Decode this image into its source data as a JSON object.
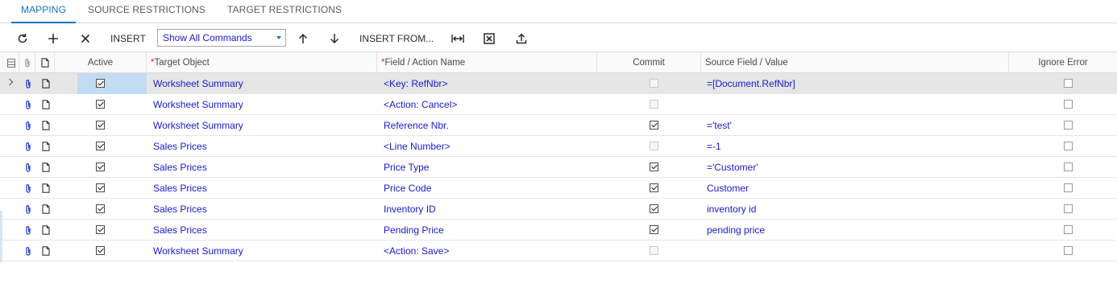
{
  "tabs": [
    {
      "label": "MAPPING"
    },
    {
      "label": "SOURCE RESTRICTIONS"
    },
    {
      "label": "TARGET RESTRICTIONS"
    }
  ],
  "toolbar": {
    "refresh_icon": "refresh-icon",
    "add_icon": "plus-icon",
    "delete_icon": "close-icon",
    "insert_label": "INSERT",
    "commands_select": "Show All Commands",
    "up_icon": "arrow-up-icon",
    "down_icon": "arrow-down-icon",
    "insert_from_label": "INSERT FROM...",
    "fit_icon": "fit-columns-icon",
    "excel_icon": "export-excel-icon",
    "upload_icon": "upload-icon"
  },
  "columns": {
    "active": "Active",
    "target_object": "Target Object",
    "field_action": "Field / Action Name",
    "commit": "Commit",
    "source_value": "Source Field / Value",
    "ignore_error": "Ignore Error",
    "required_mark": "*"
  },
  "rows": [
    {
      "active": true,
      "target": "Worksheet Summary",
      "field": "<Key: RefNbr>",
      "commit": false,
      "commit_enabled": false,
      "source": "=[Document.RefNbr]",
      "ignore": false,
      "selected": true
    },
    {
      "active": true,
      "target": "Worksheet Summary",
      "field": "<Action: Cancel>",
      "commit": false,
      "commit_enabled": false,
      "source": "",
      "ignore": false,
      "selected": false
    },
    {
      "active": true,
      "target": "Worksheet Summary",
      "field": "Reference Nbr.",
      "commit": true,
      "commit_enabled": true,
      "source": "='test'",
      "ignore": false,
      "selected": false
    },
    {
      "active": true,
      "target": "Sales Prices",
      "field": "<Line Number>",
      "commit": false,
      "commit_enabled": false,
      "source": "=-1",
      "ignore": false,
      "selected": false
    },
    {
      "active": true,
      "target": "Sales Prices",
      "field": "Price Type",
      "commit": true,
      "commit_enabled": true,
      "source": "='Customer'",
      "ignore": false,
      "selected": false
    },
    {
      "active": true,
      "target": "Sales Prices",
      "field": "Price Code",
      "commit": true,
      "commit_enabled": true,
      "source": "Customer",
      "ignore": false,
      "selected": false
    },
    {
      "active": true,
      "target": "Sales Prices",
      "field": "Inventory ID",
      "commit": true,
      "commit_enabled": true,
      "source": "inventory id",
      "ignore": false,
      "selected": false
    },
    {
      "active": true,
      "target": "Sales Prices",
      "field": "Pending Price",
      "commit": true,
      "commit_enabled": true,
      "source": "pending price",
      "ignore": false,
      "selected": false
    },
    {
      "active": true,
      "target": "Worksheet Summary",
      "field": "<Action: Save>",
      "commit": false,
      "commit_enabled": false,
      "source": "",
      "ignore": false,
      "selected": false
    }
  ],
  "colors": {
    "accent": "#1a73c9",
    "link": "#1a1acc",
    "selected_row": "#e6e6e6",
    "selected_cell": "#c2dcf2"
  }
}
